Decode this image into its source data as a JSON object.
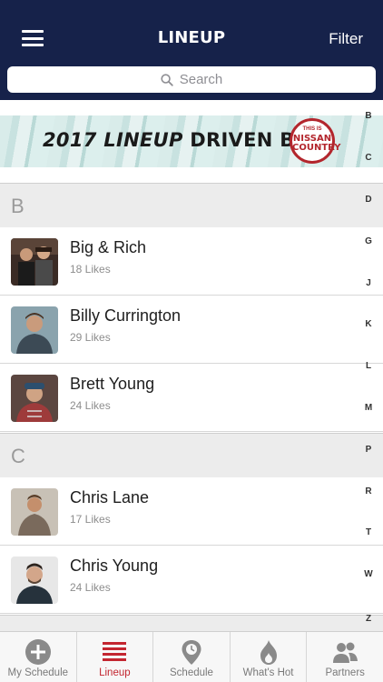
{
  "header": {
    "title": "LINEUP",
    "filter_label": "Filter",
    "menu_icon": "hamburger-icon"
  },
  "search": {
    "placeholder": "Search",
    "icon": "search-icon"
  },
  "banner": {
    "year": "2017",
    "lineup": "LINEUP",
    "driven": "DRIVEN BY",
    "logo_top": "THIS IS",
    "logo_line1": "NISSAN",
    "logo_line2": "COUNTRY"
  },
  "sections": [
    {
      "letter": "B",
      "artists": [
        {
          "name": "Big & Rich",
          "likes": "18 Likes"
        },
        {
          "name": "Billy Currington",
          "likes": "29 Likes"
        },
        {
          "name": "Brett Young",
          "likes": "24 Likes"
        }
      ]
    },
    {
      "letter": "C",
      "artists": [
        {
          "name": "Chris Lane",
          "likes": "17 Likes"
        },
        {
          "name": "Chris Young",
          "likes": "24 Likes"
        }
      ]
    }
  ],
  "index": [
    "B",
    "C",
    "D",
    "G",
    "J",
    "K",
    "L",
    "M",
    "P",
    "R",
    "T",
    "W",
    "Z"
  ],
  "tabs": [
    {
      "label": "My Schedule",
      "icon": "plus-circle-icon",
      "active": false
    },
    {
      "label": "Lineup",
      "icon": "list-icon",
      "active": true
    },
    {
      "label": "Schedule",
      "icon": "map-pin-icon",
      "active": false
    },
    {
      "label": "What's Hot",
      "icon": "flame-icon",
      "active": false
    },
    {
      "label": "Partners",
      "icon": "people-icon",
      "active": false
    }
  ],
  "colors": {
    "header_bg": "#16224a",
    "accent": "#c32630",
    "section_bg": "#ececec"
  }
}
